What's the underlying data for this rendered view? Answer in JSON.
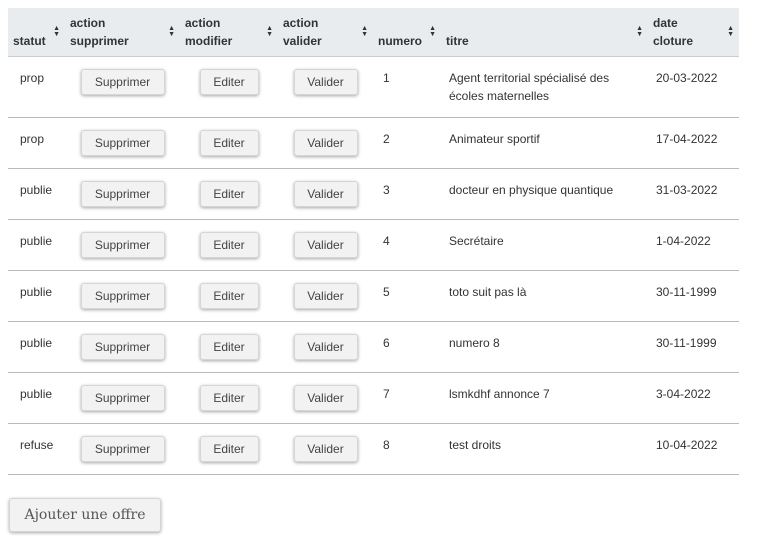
{
  "table": {
    "headers": {
      "statut": "statut",
      "supprimer": [
        "action",
        "supprimer"
      ],
      "modifier": [
        "action",
        "modifier"
      ],
      "valider": [
        "action",
        "valider"
      ],
      "numero": "numero",
      "titre": "titre",
      "date": [
        "date",
        "cloture"
      ]
    },
    "sort_icon": "sort-arrows-icon",
    "rows": [
      {
        "statut": "prop",
        "supprimer": "Supprimer",
        "editer": "Editer",
        "valider": "Valider",
        "numero": "1",
        "titre": "Agent territorial spécialisé des écoles maternelles",
        "date": "20-03-2022"
      },
      {
        "statut": "prop",
        "supprimer": "Supprimer",
        "editer": "Editer",
        "valider": "Valider",
        "numero": "2",
        "titre": "Animateur sportif",
        "date": "17-04-2022"
      },
      {
        "statut": "publie",
        "supprimer": "Supprimer",
        "editer": "Editer",
        "valider": "Valider",
        "numero": "3",
        "titre": "docteur en physique quantique",
        "date": "31-03-2022"
      },
      {
        "statut": "publie",
        "supprimer": "Supprimer",
        "editer": "Editer",
        "valider": "Valider",
        "numero": "4",
        "titre": "Secrétaire",
        "date": "1-04-2022"
      },
      {
        "statut": "publie",
        "supprimer": "Supprimer",
        "editer": "Editer",
        "valider": "Valider",
        "numero": "5",
        "titre": "toto suit pas là",
        "date": "30-11-1999"
      },
      {
        "statut": "publie",
        "supprimer": "Supprimer",
        "editer": "Editer",
        "valider": "Valider",
        "numero": "6",
        "titre": "numero 8",
        "date": "30-11-1999"
      },
      {
        "statut": "publie",
        "supprimer": "Supprimer",
        "editer": "Editer",
        "valider": "Valider",
        "numero": "7",
        "titre": "lsmkdhf annonce 7",
        "date": "3-04-2022"
      },
      {
        "statut": "refuse",
        "supprimer": "Supprimer",
        "editer": "Editer",
        "valider": "Valider",
        "numero": "8",
        "titre": "test droits",
        "date": "10-04-2022"
      }
    ]
  },
  "add_button": "Ajouter une offre",
  "colors": {
    "header_bg": "#e8ecef",
    "button_bg": "#f2f2f2",
    "row_border": "#bbbbbb"
  }
}
